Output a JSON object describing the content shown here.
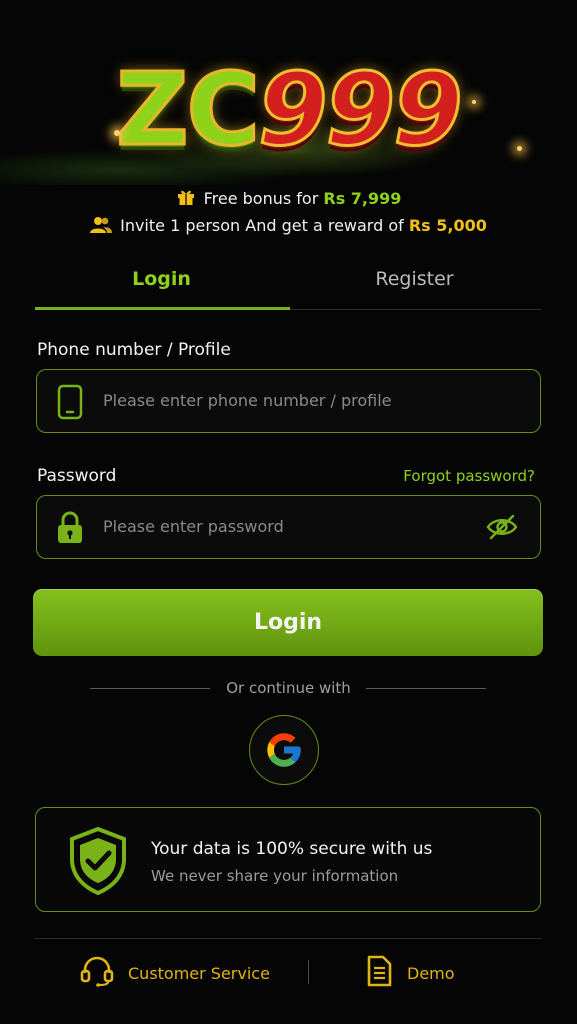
{
  "brand": {
    "logo_primary": "ZC",
    "logo_secondary": "999",
    "colors": {
      "accent": "#8fd21a",
      "logo_red": "#d41f1f",
      "gold": "#f0c019",
      "background": "#050505"
    }
  },
  "promo": {
    "bonus_prefix": "Free bonus for ",
    "bonus_amount": "Rs 7,999",
    "bonus_icon": "gift-icon",
    "invite_prefix": "Invite 1 person And get a reward of ",
    "invite_amount": "Rs 5,000",
    "invite_icon": "users-icon"
  },
  "tabs": [
    {
      "label": "Login",
      "active": true
    },
    {
      "label": "Register",
      "active": false
    }
  ],
  "form": {
    "phone_label": "Phone number / Profile",
    "phone_placeholder": "Please enter phone number / profile",
    "phone_icon": "phone-icon",
    "password_label": "Password",
    "forgot_link": "Forgot password?",
    "password_placeholder": "Please enter password",
    "password_icon": "lock-icon",
    "visibility_icon": "eye-off-icon",
    "submit_label": "Login"
  },
  "social": {
    "divider_text": "Or continue with",
    "providers": [
      {
        "icon": "google-icon"
      }
    ]
  },
  "security": {
    "icon": "shield-check-icon",
    "title": "Your data is 100% secure with us",
    "subtitle": "We never share your information"
  },
  "footer": {
    "customer_service_label": "Customer Service",
    "customer_service_icon": "headset-icon",
    "demo_label": "Demo",
    "demo_icon": "document-icon"
  }
}
